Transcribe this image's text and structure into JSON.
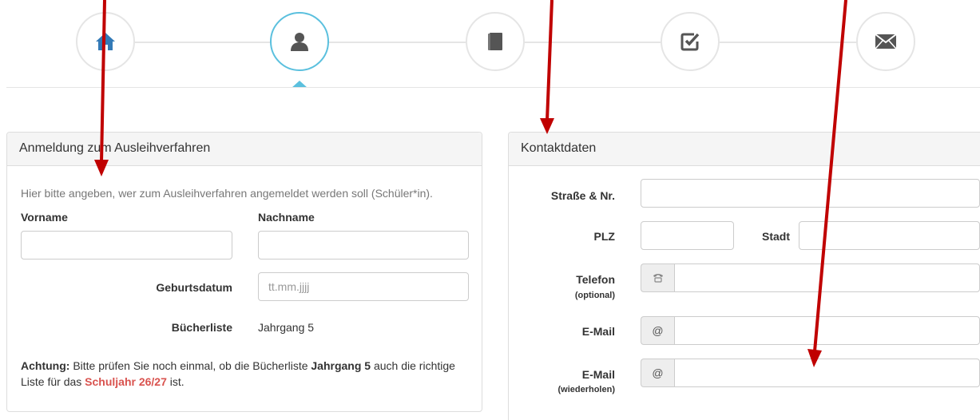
{
  "wizard": {
    "steps": [
      {
        "icon": "home-icon",
        "active": false
      },
      {
        "icon": "user-icon",
        "active": true
      },
      {
        "icon": "book-icon",
        "active": false
      },
      {
        "icon": "checkbox-icon",
        "active": false
      },
      {
        "icon": "envelope-icon",
        "active": false
      }
    ],
    "colors": {
      "active": "#5bc0de",
      "inactive": "#e5e5e5",
      "home_icon": "#337ab7",
      "icon": "#555555"
    }
  },
  "registration": {
    "title": "Anmeldung zum Ausleihverfahren",
    "help_text": "Hier bitte angeben, wer zum Ausleihverfahren angemeldet werden soll (Schüler*in).",
    "first_name_label": "Vorname",
    "first_name_value": "",
    "last_name_label": "Nachname",
    "last_name_value": "",
    "birthdate_label": "Geburtsdatum",
    "birthdate_placeholder": "tt.mm.jjjj",
    "booklist_label": "Bücherliste",
    "booklist_value": "Jahrgang 5",
    "note_prefix": "Achtung:",
    "note_part1": " Bitte prüfen Sie noch einmal, ob die Bücherliste ",
    "note_booklist": "Jahrgang 5",
    "note_part2": " auch die richtige Liste für das ",
    "note_schoolyear": "Schuljahr 26/27",
    "note_part3": " ist.",
    "accent_color": "#d9534f"
  },
  "contact": {
    "title": "Kontaktdaten",
    "street_label": "Straße & Nr.",
    "street_value": "",
    "zip_label": "PLZ",
    "zip_value": "",
    "city_label": "Stadt",
    "city_value": "",
    "phone_label": "Telefon",
    "phone_sublabel": "(optional)",
    "phone_icon": "phone-icon",
    "phone_value": "",
    "email_label": "E-Mail",
    "email_addon": "@",
    "email_value": "",
    "email_repeat_label": "E-Mail",
    "email_repeat_sublabel": "(wiederholen)",
    "email_repeat_addon": "@",
    "email_repeat_value": ""
  },
  "annotations": {
    "arrow_color": "#c00000"
  }
}
